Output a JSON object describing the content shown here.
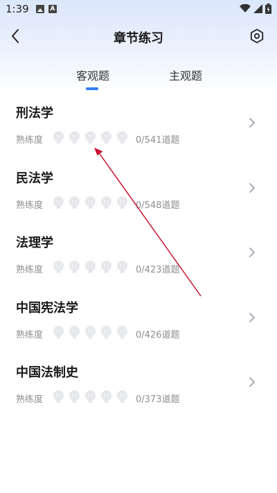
{
  "status_bar": {
    "time": "1:39"
  },
  "nav": {
    "title": "章节练习"
  },
  "tabs": [
    {
      "label": "客观题",
      "active": true
    },
    {
      "label": "主观题",
      "active": false
    }
  ],
  "proficiency_label": "熟练度",
  "subjects": [
    {
      "name": "刑法学",
      "count": "0/541道题",
      "proficiency": 0
    },
    {
      "name": "民法学",
      "count": "0/548道题",
      "proficiency": 0
    },
    {
      "name": "法理学",
      "count": "0/423道题",
      "proficiency": 0
    },
    {
      "name": "中国宪法学",
      "count": "0/426道题",
      "proficiency": 0
    },
    {
      "name": "中国法制史",
      "count": "0/373道题",
      "proficiency": 0
    }
  ],
  "colors": {
    "accent": "#2f80ed",
    "annotation_arrow": "#c8102e",
    "bulb_inactive": "#e6e8ec"
  },
  "icons": {
    "back": "chevron-left-icon",
    "settings": "hexagon-settings-icon",
    "proficiency": "lightbulb-icon",
    "row_action": "chevron-right-icon"
  }
}
